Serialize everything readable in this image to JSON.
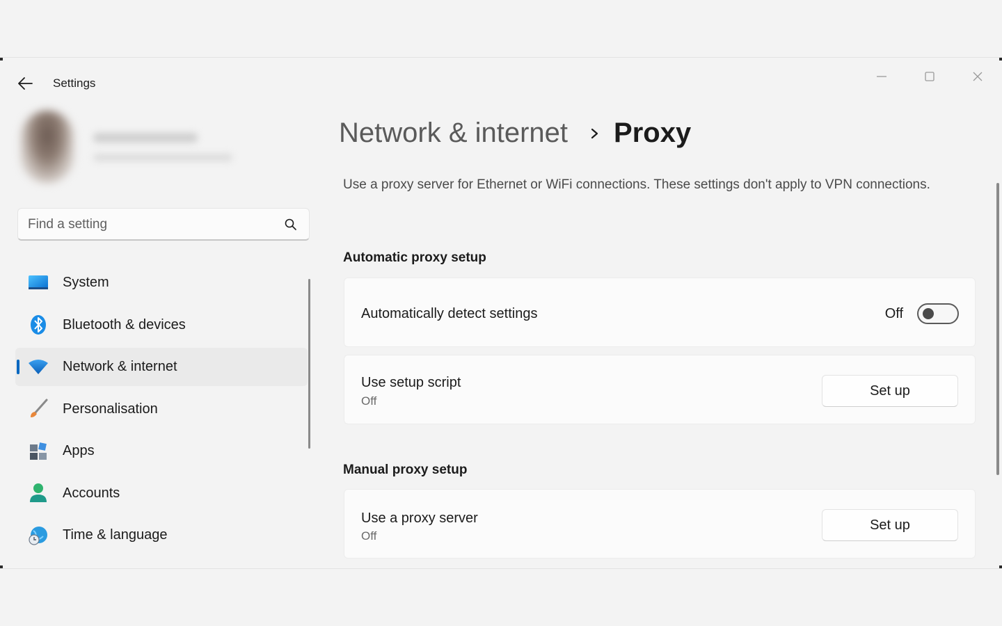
{
  "window": {
    "title": "Settings"
  },
  "search": {
    "placeholder": "Find a setting"
  },
  "sidebar": {
    "items": [
      {
        "label": "System",
        "icon": "monitor-icon"
      },
      {
        "label": "Bluetooth & devices",
        "icon": "bluetooth-icon"
      },
      {
        "label": "Network & internet",
        "icon": "wifi-icon",
        "selected": true
      },
      {
        "label": "Personalisation",
        "icon": "paintbrush-icon"
      },
      {
        "label": "Apps",
        "icon": "apps-icon"
      },
      {
        "label": "Accounts",
        "icon": "person-icon"
      },
      {
        "label": "Time & language",
        "icon": "globe-clock-icon"
      }
    ]
  },
  "breadcrumb": {
    "parent": "Network & internet",
    "current": "Proxy"
  },
  "main": {
    "description": "Use a proxy server for Ethernet or WiFi connections. These settings don't apply to VPN connections.",
    "automatic": {
      "section_title": "Automatic proxy setup",
      "detect": {
        "title": "Automatically detect settings",
        "state_label": "Off",
        "on": false
      },
      "script": {
        "title": "Use setup script",
        "status": "Off",
        "button_label": "Set up"
      }
    },
    "manual": {
      "section_title": "Manual proxy setup",
      "proxy_server": {
        "title": "Use a proxy server",
        "status": "Off",
        "button_label": "Set up"
      }
    }
  },
  "colors": {
    "accent": "#0067c0",
    "background": "#f3f3f3",
    "card": "#fbfbfb"
  }
}
